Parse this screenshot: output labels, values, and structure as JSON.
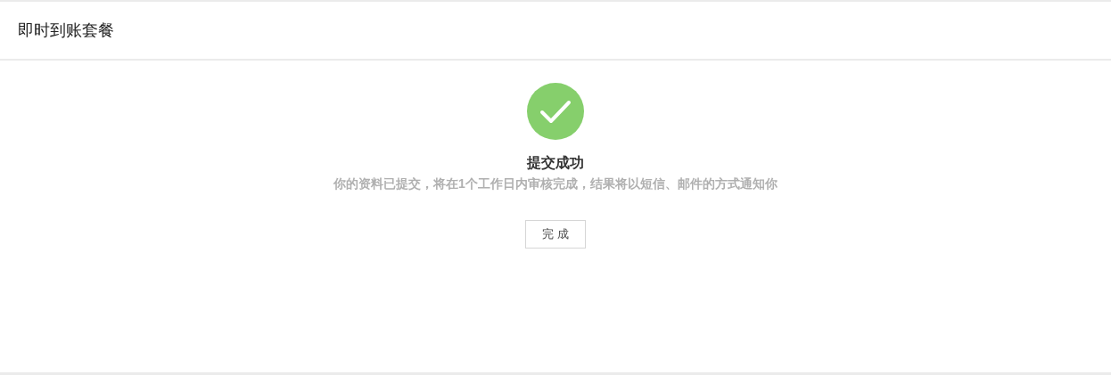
{
  "header": {
    "title": "即时到账套餐"
  },
  "result": {
    "kind": "success",
    "title": "提交成功",
    "message": "你的资料已提交，将在1个工作日内审核完成，结果将以短信、邮件的方式通知你"
  },
  "buttons": [
    {
      "label": "完成"
    }
  ]
}
